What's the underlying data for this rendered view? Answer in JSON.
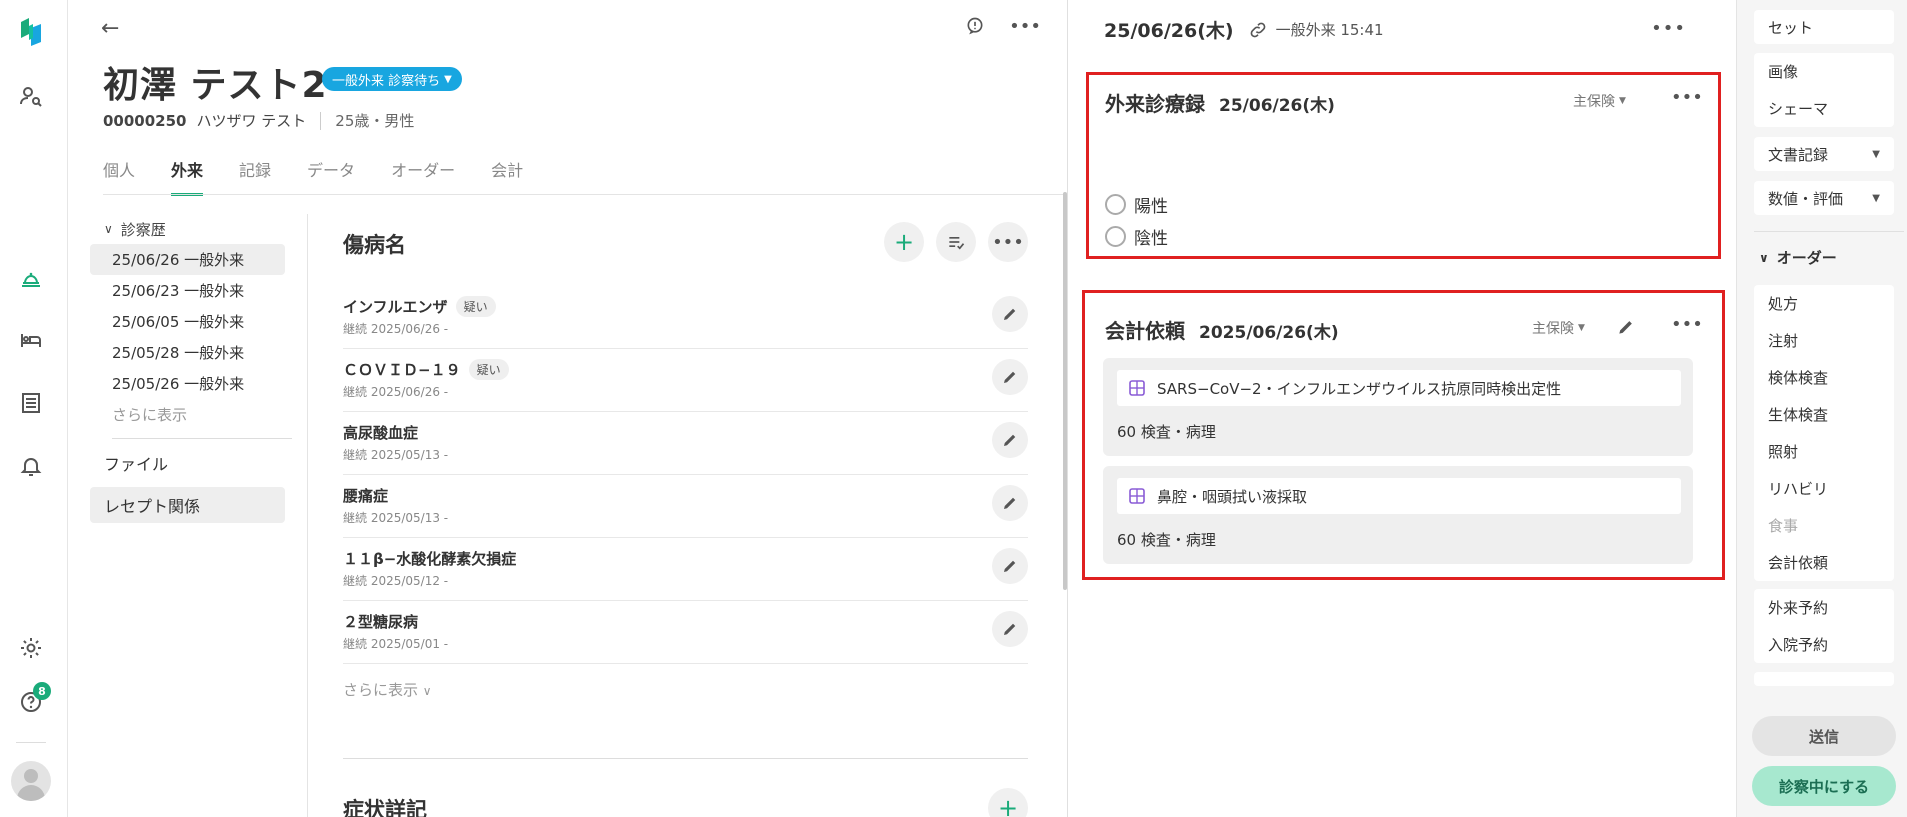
{
  "patient": {
    "name": "初澤 テスト2",
    "status": "一般外来 診察待ち",
    "id": "00000250",
    "kana": "ハツザワ テスト",
    "age_sex": "25歳・男性"
  },
  "tabs": [
    {
      "label": "個人"
    },
    {
      "label": "外来"
    },
    {
      "label": "記録"
    },
    {
      "label": "データ"
    },
    {
      "label": "オーダー"
    },
    {
      "label": "会計"
    }
  ],
  "history": {
    "title": "診察歴",
    "items": [
      {
        "label": "25/06/26 一般外来"
      },
      {
        "label": "25/06/23 一般外来"
      },
      {
        "label": "25/06/05 一般外来"
      },
      {
        "label": "25/05/28 一般外来"
      },
      {
        "label": "25/05/26 一般外来"
      }
    ],
    "more": "さらに表示",
    "file": "ファイル",
    "receipt": "レセプト関係"
  },
  "diseases": {
    "title": "傷病名",
    "items": [
      {
        "name": "インフルエンザ",
        "tag": "疑い",
        "sub": "継続 2025/06/26 -"
      },
      {
        "name": "ＣＯＶＩＤ−１９",
        "tag": "疑い",
        "sub": "継続 2025/06/26 -"
      },
      {
        "name": "高尿酸血症",
        "tag": "",
        "sub": "継続 2025/05/13 -"
      },
      {
        "name": "腰痛症",
        "tag": "",
        "sub": "継続 2025/05/13 -"
      },
      {
        "name": "１１β−水酸化酵素欠損症",
        "tag": "",
        "sub": "継続 2025/05/12 -"
      },
      {
        "name": "２型糖尿病",
        "tag": "",
        "sub": "継続 2025/05/01 -"
      }
    ],
    "more": "さらに表示"
  },
  "symptoms": {
    "title": "症状詳記"
  },
  "record": {
    "date": "25/06/26(木)",
    "visit": "一般外来 15:41",
    "card1": {
      "title": "外来診療録",
      "date": "25/06/26(木)",
      "insurance": "主保険",
      "options": [
        "陽性",
        "陰性"
      ]
    },
    "card2": {
      "title": "会計依頼",
      "date": "2025/06/26(木)",
      "insurance": "主保険",
      "orders": [
        {
          "name": "SARS−CoV−2・インフルエンザウイルス抗原同時検出定性",
          "category": "60 検査・病理"
        },
        {
          "name": "鼻腔・咽頭拭い液採取",
          "category": "60 検査・病理"
        }
      ]
    }
  },
  "side_menu": {
    "top": [
      "セット"
    ],
    "group1": [
      "画像",
      "シェーマ"
    ],
    "doc": "文書記録",
    "num": "数値・評価",
    "order_section": "オーダー",
    "order_items": [
      "処方",
      "注射",
      "検体検査",
      "生体検査",
      "照射",
      "リハビリ",
      "食事",
      "会計依頼"
    ],
    "reserve_items": [
      "外来予約",
      "入院予約"
    ],
    "send": "送信",
    "start": "診察中にする"
  },
  "notifications": {
    "count": "8"
  },
  "colors": {
    "accent": "#1aab7a",
    "status": "#18a6e0",
    "highlight": "#e02020",
    "order_icon": "#8a5cd6"
  }
}
